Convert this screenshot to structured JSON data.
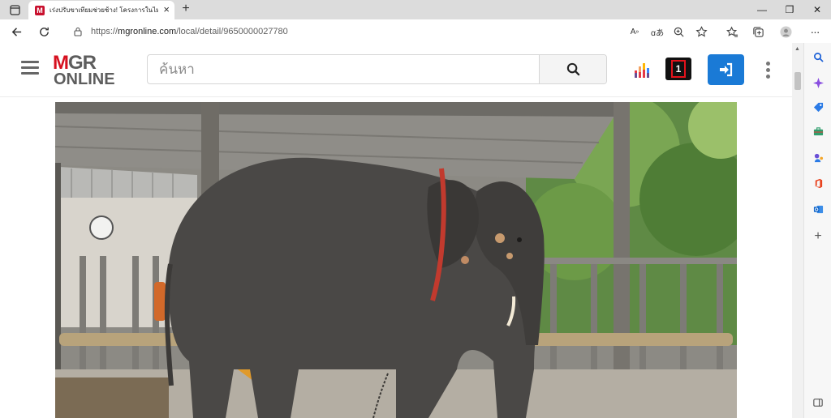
{
  "browser": {
    "tab_title": "เร่งปรับขาเทียมช่วยช้าง! โครงการในไม่...",
    "tab_close": "×",
    "new_tab": "+",
    "favicon_letter": "M",
    "url_prefix": "https://",
    "url_host": "mgronline.com",
    "url_path": "/local/detail/9650000027780",
    "window_controls": [
      "—",
      "❐",
      "✕"
    ]
  },
  "site": {
    "logo_top": "MGR",
    "logo_bottom": "ONLINE",
    "search_placeholder": "ค้นหา",
    "channel_number": "1"
  },
  "colors": {
    "brand_red": "#d6101f",
    "login_blue": "#1a7ad6"
  },
  "icons": [
    "tab-actions-icon",
    "back-icon",
    "refresh-icon",
    "lock-icon",
    "read-aloud-icon",
    "translate-icon",
    "zoom-icon",
    "favorite-add-icon",
    "favorites-icon",
    "collections-icon",
    "profile-icon",
    "more-icon",
    "search-icon",
    "hamburger-icon",
    "podcast-icon",
    "channel-1-icon",
    "login-icon",
    "kebab-icon",
    "bing-search-icon",
    "copilot-icon",
    "shopping-icon",
    "tools-icon",
    "games-icon",
    "office-icon",
    "outlook-icon",
    "add-icon",
    "sidebar-toggle-icon"
  ]
}
